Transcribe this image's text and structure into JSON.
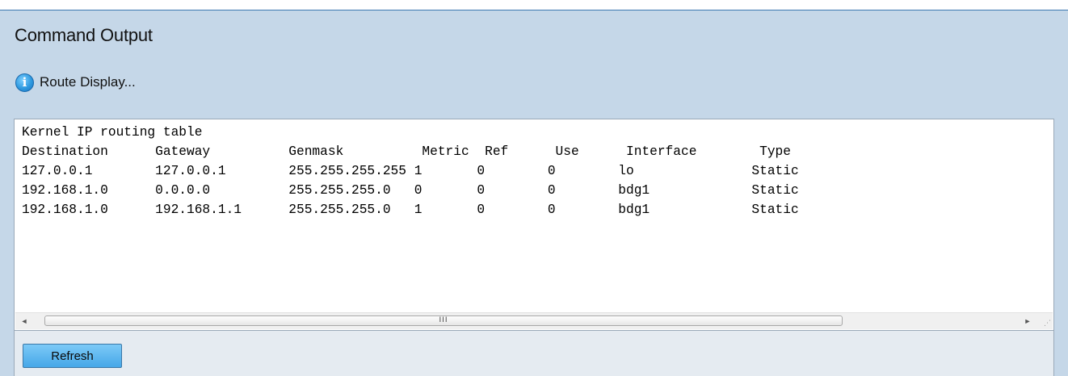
{
  "panel": {
    "title": "Command Output",
    "info_message": "Route Display..."
  },
  "output": {
    "lines": [
      "Kernel IP routing table",
      "Destination      Gateway          Genmask          Metric  Ref      Use      Interface        Type",
      "127.0.0.1        127.0.0.1        255.255.255.255 1       0        0        lo               Static",
      "192.168.1.0      0.0.0.0          255.255.255.0   0       0        0        bdg1             Static",
      "192.168.1.0      192.168.1.1      255.255.255.0   1       0        0        bdg1             Static"
    ]
  },
  "scrollbar": {
    "left_arrow": "◄",
    "right_arrow": "►",
    "grip": "III",
    "resize": "⋰"
  },
  "actions": {
    "refresh_label": "Refresh"
  },
  "icons": {
    "info": "i"
  },
  "colors": {
    "panel_bg": "#c5d7e8",
    "button_bg": "#46a7e8",
    "info_icon": "#2f9ae0"
  }
}
